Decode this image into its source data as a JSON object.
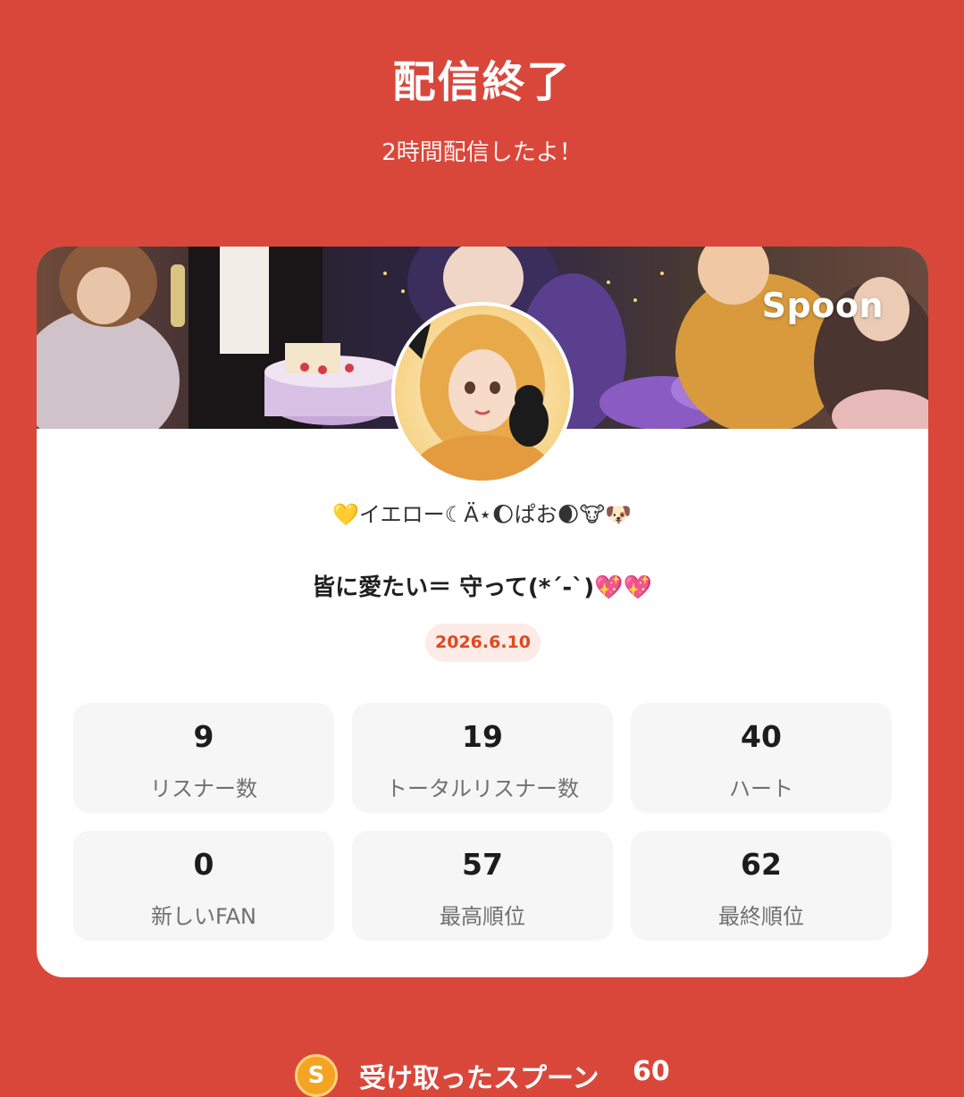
{
  "header": {
    "title": "配信終了",
    "subtitle": "2時間配信したよ！"
  },
  "card": {
    "brand": "Spoon",
    "nickname": "💛イエロー☾Ä⋆🌔ぱお🌒🐮🐶",
    "stream_title": "皆に愛たい＝ 守って(*´-`)💖💖",
    "date": "2026.6.10",
    "stats": [
      {
        "value": "9",
        "label": "リスナー数"
      },
      {
        "value": "19",
        "label": "トータルリスナー数"
      },
      {
        "value": "40",
        "label": "ハート"
      },
      {
        "value": "0",
        "label": "新しいFAN"
      },
      {
        "value": "57",
        "label": "最高順位"
      },
      {
        "value": "62",
        "label": "最終順位"
      }
    ]
  },
  "received": {
    "icon_letter": "S",
    "label": "受け取ったスプーン",
    "value": "60"
  },
  "colors": {
    "background": "#d9473b",
    "card": "#ffffff",
    "date_badge_bg": "#fdebe6",
    "date_badge_text": "#e0491f",
    "spoon_icon": "#f4a323"
  }
}
